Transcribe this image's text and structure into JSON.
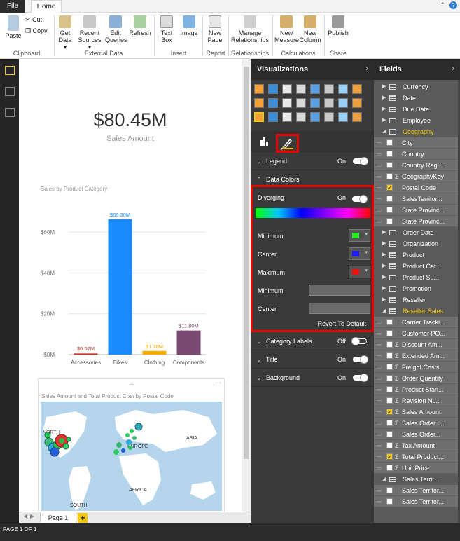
{
  "ribbon_tabs": {
    "file": "File",
    "home": "Home"
  },
  "ribbon": {
    "groups": [
      {
        "label": "Clipboard"
      },
      {
        "label": "External Data"
      },
      {
        "label": "Insert"
      },
      {
        "label": "Report"
      },
      {
        "label": "Relationships"
      },
      {
        "label": "Calculations"
      },
      {
        "label": "Share"
      }
    ],
    "paste": "Paste",
    "cut": "Cut",
    "copy": "Copy",
    "get_data": "Get Data ▾",
    "recent_sources": "Recent Sources ▾",
    "edit_queries": "Edit Queries",
    "refresh": "Refresh",
    "text_box": "Text Box",
    "image": "Image",
    "new_page": "New Page",
    "manage_relationships": "Manage Relationships",
    "new_measure": "New Measure",
    "new_column": "New Column",
    "publish": "Publish"
  },
  "kpi": {
    "value": "$80.45M",
    "label": "Sales Amount"
  },
  "chart_data": [
    {
      "type": "bar",
      "title": "Sales by Product Category",
      "categories": [
        "Accessories",
        "Bikes",
        "Clothing",
        "Components"
      ],
      "values": [
        0.57,
        66.3,
        1.78,
        11.8
      ],
      "data_labels": [
        "$0.57M",
        "$66.30M",
        "$1.78M",
        "$11.80M"
      ],
      "bar_colors": [
        "#c0392b",
        "#1a8cff",
        "#f2a900",
        "#7b4a72"
      ],
      "yticks": [
        "$0M",
        "$20M",
        "$40M",
        "$60M"
      ],
      "ytick_values": [
        0,
        20,
        40,
        60
      ],
      "ylim": [
        0,
        70
      ],
      "grid": true
    }
  ],
  "map": {
    "title": "Sales Amount and Total Product Cost by Postal Code",
    "labels": {
      "north": "NORTH",
      "europe": "EUROPE",
      "asia": "ASIA",
      "africa": "AFRICA",
      "south": "SOUTH"
    }
  },
  "pages": {
    "tab": "Page 1",
    "add": "+"
  },
  "status": "PAGE 1 OF 1",
  "visualizations": {
    "header": "Visualizations",
    "sections": {
      "legend": {
        "label": "Legend",
        "state": "On"
      },
      "data_colors": {
        "label": "Data Colors"
      },
      "category_labels": {
        "label": "Category Labels",
        "state": "Off"
      },
      "title": {
        "label": "Title",
        "state": "On"
      },
      "background": {
        "label": "Background",
        "state": "On"
      }
    },
    "diverging": {
      "label": "Diverging",
      "state": "On"
    },
    "colors": [
      {
        "label": "Minimum",
        "color": "#22ee22"
      },
      {
        "label": "Center",
        "color": "#1a1aff"
      },
      {
        "label": "Maximum",
        "color": "#ee1111"
      }
    ],
    "numeric": [
      {
        "label": "Minimum"
      },
      {
        "label": "Center"
      }
    ],
    "revert": "Revert To Default"
  },
  "fields": {
    "header": "Fields",
    "items": [
      {
        "kind": "table",
        "name": "Currency"
      },
      {
        "kind": "table",
        "name": "Date"
      },
      {
        "kind": "table",
        "name": "Due Date"
      },
      {
        "kind": "table",
        "name": "Employee"
      },
      {
        "kind": "table",
        "name": "Geography",
        "expanded": true,
        "highlight": true
      },
      {
        "kind": "field",
        "name": "City"
      },
      {
        "kind": "field",
        "name": "Country"
      },
      {
        "kind": "field",
        "name": "Country Regi..."
      },
      {
        "kind": "field",
        "name": "GeographyKey",
        "sigma": true
      },
      {
        "kind": "field",
        "name": "Postal Code",
        "checked": true
      },
      {
        "kind": "field",
        "name": "SalesTerritor..."
      },
      {
        "kind": "field",
        "name": "State Provinc..."
      },
      {
        "kind": "field",
        "name": "State Provinc..."
      },
      {
        "kind": "table",
        "name": "Order Date"
      },
      {
        "kind": "table",
        "name": "Organization"
      },
      {
        "kind": "table",
        "name": "Product"
      },
      {
        "kind": "table",
        "name": "Product Cat..."
      },
      {
        "kind": "table",
        "name": "Product Su..."
      },
      {
        "kind": "table",
        "name": "Promotion"
      },
      {
        "kind": "table",
        "name": "Reseller"
      },
      {
        "kind": "table",
        "name": "Reseller Sales",
        "expanded": true,
        "highlight": true
      },
      {
        "kind": "field",
        "name": "Carrier Tracki..."
      },
      {
        "kind": "field",
        "name": "Customer PO..."
      },
      {
        "kind": "field",
        "name": "Discount Am...",
        "sigma": true
      },
      {
        "kind": "field",
        "name": "Extended Am...",
        "sigma": true
      },
      {
        "kind": "field",
        "name": "Freight Costs",
        "sigma": true
      },
      {
        "kind": "field",
        "name": "Order Quantity",
        "sigma": true
      },
      {
        "kind": "field",
        "name": "Product Stan...",
        "sigma": true
      },
      {
        "kind": "field",
        "name": "Revision Nu...",
        "sigma": true
      },
      {
        "kind": "field",
        "name": "Sales Amount",
        "sigma": true,
        "checked": true
      },
      {
        "kind": "field",
        "name": "Sales Order L...",
        "sigma": true
      },
      {
        "kind": "field",
        "name": "Sales Order..."
      },
      {
        "kind": "field",
        "name": "Tax Amount",
        "sigma": true
      },
      {
        "kind": "field",
        "name": "Total Product...",
        "sigma": true,
        "checked": true
      },
      {
        "kind": "field",
        "name": "Unit Price",
        "sigma": true
      },
      {
        "kind": "table",
        "name": "Sales Territ...",
        "expanded": true
      },
      {
        "kind": "field",
        "name": "Sales Territor..."
      },
      {
        "kind": "field",
        "name": "Sales Territor..."
      }
    ]
  }
}
